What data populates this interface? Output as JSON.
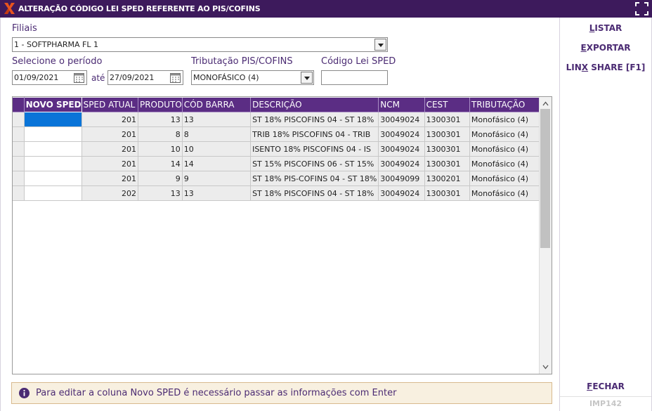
{
  "window": {
    "title": "ALTERAÇÃO CÓDIGO LEI SPED REFERENTE AO PIS/COFINS"
  },
  "form": {
    "filiais_label": "Filiais",
    "filial_value": "1 - SOFTPHARMA FL 1",
    "periodo_label": "Selecione o período",
    "data_inicio": "01/09/2021",
    "ate_label": "até",
    "data_fim": "27/09/2021",
    "tributacao_label": "Tributação PIS/COFINS",
    "tributacao_value": "MONOFÁSICO (4)",
    "codigo_label": "Código Lei SPED",
    "codigo_value": ""
  },
  "grid": {
    "columns": [
      "NOVO SPED",
      "SPED ATUAL",
      "PRODUTO",
      "CÓD BARRA",
      "DESCRIÇÃO",
      "NCM",
      "CEST",
      "TRIBUTAÇÃO"
    ],
    "rows": [
      {
        "novo_sped": "",
        "sped_atual": "201",
        "produto": "13",
        "cod_barra": "13",
        "descricao": "ST 18% PISCOFINS 04 - ST 18%",
        "ncm": "30049024",
        "cest": "1300301",
        "tributacao": "Monofásico (4)"
      },
      {
        "novo_sped": "",
        "sped_atual": "201",
        "produto": "8",
        "cod_barra": "8",
        "descricao": "TRIB 18% PISCOFINS 04 - TRIB",
        "ncm": "30049024",
        "cest": "1300301",
        "tributacao": "Monofásico (4)"
      },
      {
        "novo_sped": "",
        "sped_atual": "201",
        "produto": "10",
        "cod_barra": "10",
        "descricao": "ISENTO 18% PISCOFINS 04 - IS",
        "ncm": "30049024",
        "cest": "1300301",
        "tributacao": "Monofásico (4)"
      },
      {
        "novo_sped": "",
        "sped_atual": "201",
        "produto": "14",
        "cod_barra": "14",
        "descricao": "ST 15% PISCOFINS 06 - ST 15%",
        "ncm": "30049024",
        "cest": "1300301",
        "tributacao": "Monofásico (4)"
      },
      {
        "novo_sped": "",
        "sped_atual": "201",
        "produto": "9",
        "cod_barra": "9",
        "descricao": "ST 18% PIS-COFINS 04 - ST 18%",
        "ncm": "30049099",
        "cest": "1300201",
        "tributacao": "Monofásico (4)"
      },
      {
        "novo_sped": "",
        "sped_atual": "202",
        "produto": "13",
        "cod_barra": "13",
        "descricao": "ST 18% PISCOFINS 04 - ST 18%",
        "ncm": "30049024",
        "cest": "1300301",
        "tributacao": "Monofásico (4)"
      }
    ]
  },
  "info": {
    "message": "Para editar a coluna Novo SPED é necessário passar as informações com Enter"
  },
  "sidebar": {
    "listar_first": "L",
    "listar_rest": "ISTAR",
    "exportar_first": "E",
    "exportar_rest": "XPORTAR",
    "linx_pre": "LIN",
    "linx_key": "X",
    "linx_rest": " SHARE [F1]",
    "fechar_first": "F",
    "fechar_rest": "ECHAR",
    "screen_code": "IMP142"
  },
  "colors": {
    "title_bar": "#3d1a5c",
    "header": "#5b2d84",
    "accent_text": "#4b2b73",
    "selection": "#0a74d8",
    "info_bg": "#f8f0e0"
  },
  "icons": {
    "logo": "linx-logo-icon",
    "expand": "expand-icon",
    "calendar": "calendar-icon",
    "dropdown": "chevron-down-icon",
    "info": "info-icon"
  }
}
